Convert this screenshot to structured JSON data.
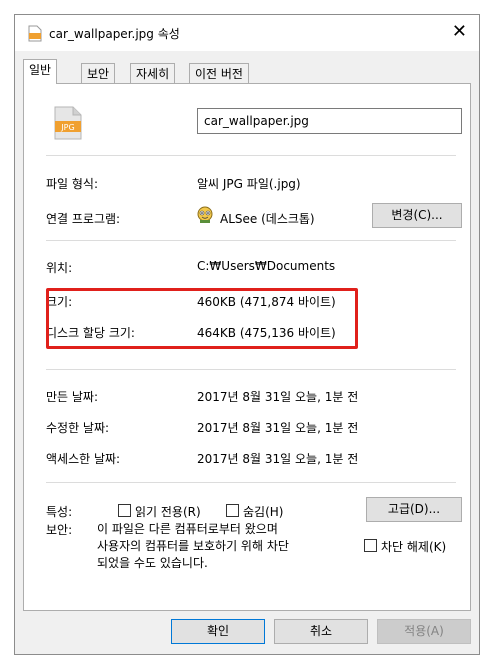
{
  "window": {
    "title": "car_wallpaper.jpg 속성",
    "close_symbol": "✕"
  },
  "tabs": [
    {
      "label": "일반",
      "active": true
    },
    {
      "label": "보안",
      "active": false
    },
    {
      "label": "자세히",
      "active": false
    },
    {
      "label": "이전 버전",
      "active": false
    }
  ],
  "general": {
    "file_icon_text": "JPG",
    "filename": "car_wallpaper.jpg",
    "file_type_label": "파일 형식:",
    "file_type_value": "알씨 JPG 파일(.jpg)",
    "opens_with_label": "연결 프로그램:",
    "opens_with_value": "ALSee (데스크톱)",
    "change_button": "변경(C)...",
    "location_label": "위치:",
    "location_value": "C:₩Users₩Documents",
    "size_label": "크기:",
    "size_value": "460KB (471,874 바이트)",
    "size_on_disk_label": "디스크 할당 크기:",
    "size_on_disk_value": "464KB (475,136 바이트)",
    "created_label": "만든 날짜:",
    "created_value": "2017년 8월 31일 오늘, 1분 전",
    "modified_label": "수정한 날짜:",
    "modified_value": "2017년 8월 31일 오늘, 1분 전",
    "accessed_label": "액세스한 날짜:",
    "accessed_value": "2017년 8월 31일 오늘, 1분 전",
    "attributes_label": "특성:",
    "readonly_label": "읽기 전용(R)",
    "hidden_label": "숨김(H)",
    "advanced_button": "고급(D)...",
    "security_label": "보안:",
    "security_text": "이 파일은 다른 컴퓨터로부터 왔으며\n사용자의 컴퓨터를 보호하기 위해 차단\n되었을 수도 있습니다.",
    "unblock_label": "차단 해제(K)"
  },
  "footer": {
    "ok": "확인",
    "cancel": "취소",
    "apply": "적용(A)"
  },
  "colors": {
    "highlight": "#e0201b",
    "accent": "#0078d7"
  }
}
